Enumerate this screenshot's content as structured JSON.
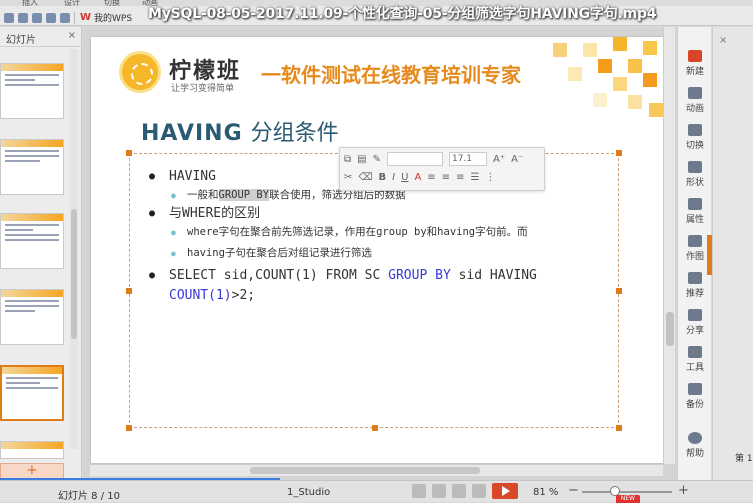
{
  "video_title": "MySQL-08-05-2017.11.09-个性化查询-05-分组筛选字句HAVING字句.mp4",
  "menu": [
    "插入",
    "设计",
    "切换",
    "动画"
  ],
  "wps_tab": "我的WPS",
  "left_panel": {
    "title": "幻灯片",
    "close": "×",
    "add": "+"
  },
  "slide": {
    "brand": "柠檬班",
    "brand_sub": "让学习变得简单",
    "slogan": "一软件测试在线教育培训专家",
    "title_bold": "HAVING",
    "title_rest": "分组条件",
    "bullets": {
      "b1": "HAVING",
      "b1_sub_pre": "一般和",
      "b1_sub_hl": "GROUP BY",
      "b1_sub_post": "联合使用，筛选分组后的数据",
      "b2": "与WHERE的区别",
      "b2_sub1": "where字句在聚合前先筛选记录，作用在group by和having字句前。而",
      "b2_sub2": "having子句在聚合后对组记录进行筛选",
      "b3_pre": "SELECT sid,COUNT(1) FROM SC ",
      "b3_blue1": "GROUP BY",
      "b3_mid": " sid HAVING",
      "b3_blue2": "COUNT(1)",
      "b3_post": ">2;"
    }
  },
  "mini_toolbar": {
    "font_size": "17.1"
  },
  "right_panel": [
    "新建",
    "动画",
    "切换",
    "形状",
    "属性",
    "作图",
    "推荐",
    "分享",
    "工具",
    "备份",
    "帮助"
  ],
  "far_right": {
    "close": "×",
    "label": "第 1"
  },
  "status": {
    "page": "幻灯片 8 / 10",
    "theme": "1_Studio",
    "zoom": "81 %",
    "minus": "−",
    "plus": "+",
    "new_badge": "NEW"
  },
  "colors": {
    "accent": "#e07b1a",
    "title": "#2a5b73",
    "blue_code": "#3a3ad6",
    "slogan": "#e68a1e"
  }
}
